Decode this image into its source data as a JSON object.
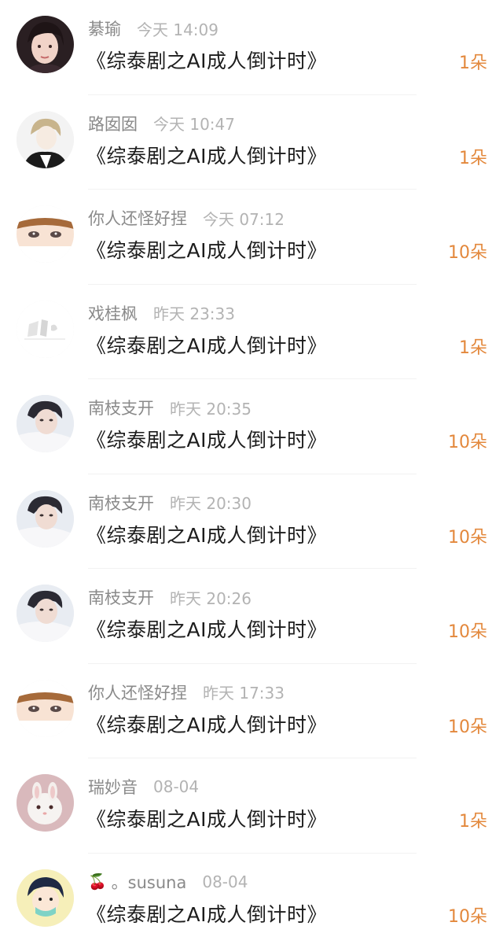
{
  "items": [
    {
      "name": "綦瑜",
      "time": "今天 14:09",
      "title": "《综泰剧之AI成人倒计时》",
      "count": "1朵",
      "avatar": "girl-dark-hair"
    },
    {
      "name": "路囡囡",
      "time": "今天 10:47",
      "title": "《综泰剧之AI成人倒计时》",
      "count": "1朵",
      "avatar": "anime-boy-suit"
    },
    {
      "name": "你人还怪好捏",
      "time": "今天 07:12",
      "title": "《综泰剧之AI成人倒计时》",
      "count": "10朵",
      "avatar": "anime-boy-eyes"
    },
    {
      "name": "戏桂枫",
      "time": "昨天 23:33",
      "title": "《综泰剧之AI成人倒计时》",
      "count": "1朵",
      "avatar": "light-sketch"
    },
    {
      "name": "南枝支开",
      "time": "昨天 20:35",
      "title": "《综泰剧之AI成人倒计时》",
      "count": "10朵",
      "avatar": "man-portrait"
    },
    {
      "name": "南枝支开",
      "time": "昨天 20:30",
      "title": "《综泰剧之AI成人倒计时》",
      "count": "10朵",
      "avatar": "man-portrait"
    },
    {
      "name": "南枝支开",
      "time": "昨天 20:26",
      "title": "《综泰剧之AI成人倒计时》",
      "count": "10朵",
      "avatar": "man-portrait"
    },
    {
      "name": "你人还怪好捏",
      "time": "昨天 17:33",
      "title": "《综泰剧之AI成人倒计时》",
      "count": "10朵",
      "avatar": "anime-boy-eyes"
    },
    {
      "name": "瑞妙音",
      "time": "08-04",
      "title": "《综泰剧之AI成人倒计时》",
      "count": "1朵",
      "avatar": "white-rabbit"
    },
    {
      "name": "。susuna",
      "time": "08-04",
      "title": "《综泰剧之AI成人倒计时》",
      "count": "10朵",
      "avatar": "cartoon-masked",
      "name_prefix_icon": "cherry-icon"
    }
  ],
  "colors": {
    "name": "#8a8a8a",
    "time": "#b3b3b3",
    "title": "#1c1c1c",
    "count": "#e3883c"
  }
}
